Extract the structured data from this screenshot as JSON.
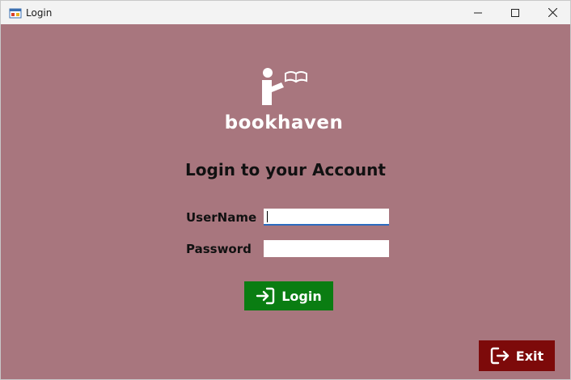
{
  "window": {
    "title": "Login",
    "icon": "app-icon",
    "controls": {
      "minimize": "minimize-icon",
      "maximize": "maximize-icon",
      "close": "close-icon"
    }
  },
  "logo": {
    "icon": "reader-with-book-icon",
    "brand": "bookhaven"
  },
  "form": {
    "heading": "Login to your Account",
    "username_label": "UserName",
    "username_value": "",
    "password_label": "Password",
    "password_value": ""
  },
  "buttons": {
    "login_label": "Login",
    "login_icon": "sign-in-arrow-icon",
    "exit_label": "Exit",
    "exit_icon": "sign-out-arrow-icon"
  },
  "colors": {
    "background": "#a8767e",
    "login_button": "#0a7d12",
    "exit_button": "#7d0a0a",
    "text": "#111111",
    "brand": "#ffffff"
  }
}
